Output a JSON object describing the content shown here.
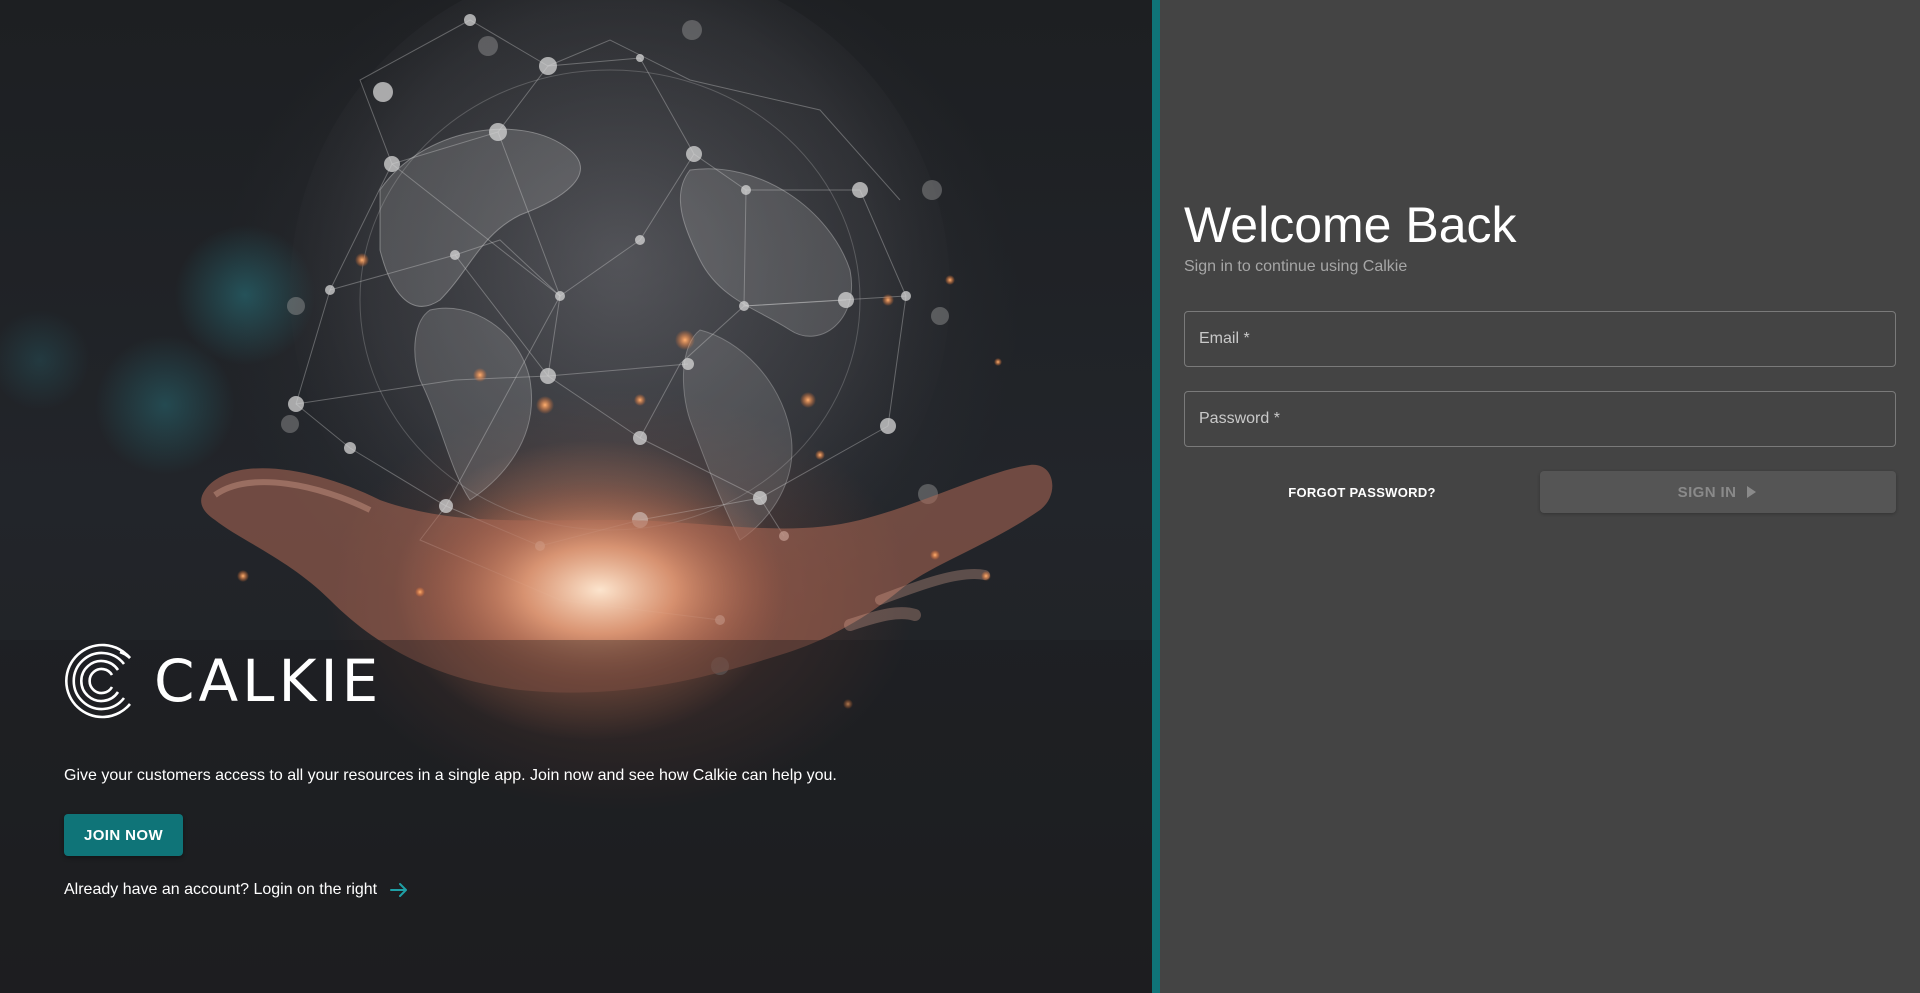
{
  "hero": {
    "brand_name": "CALKIE",
    "tagline": "Give your customers access to all your resources in a single app. Join now and see how Calkie can help you.",
    "join_label": "JOIN NOW",
    "login_hint": "Already have an account? Login on the right",
    "login_hint_icon": "arrow-right-icon",
    "accent_color": "#0f7478"
  },
  "login": {
    "title": "Welcome Back",
    "subtitle": "Sign in to continue using Calkie",
    "email_placeholder": "Email *",
    "email_value": "",
    "password_placeholder": "Password *",
    "password_value": "",
    "forgot_label": "FORGOT PASSWORD?",
    "signin_label": "SIGN IN",
    "signin_icon": "play-arrow-icon"
  },
  "colors": {
    "panel_background": "#444444",
    "divider": "#0f7478"
  }
}
